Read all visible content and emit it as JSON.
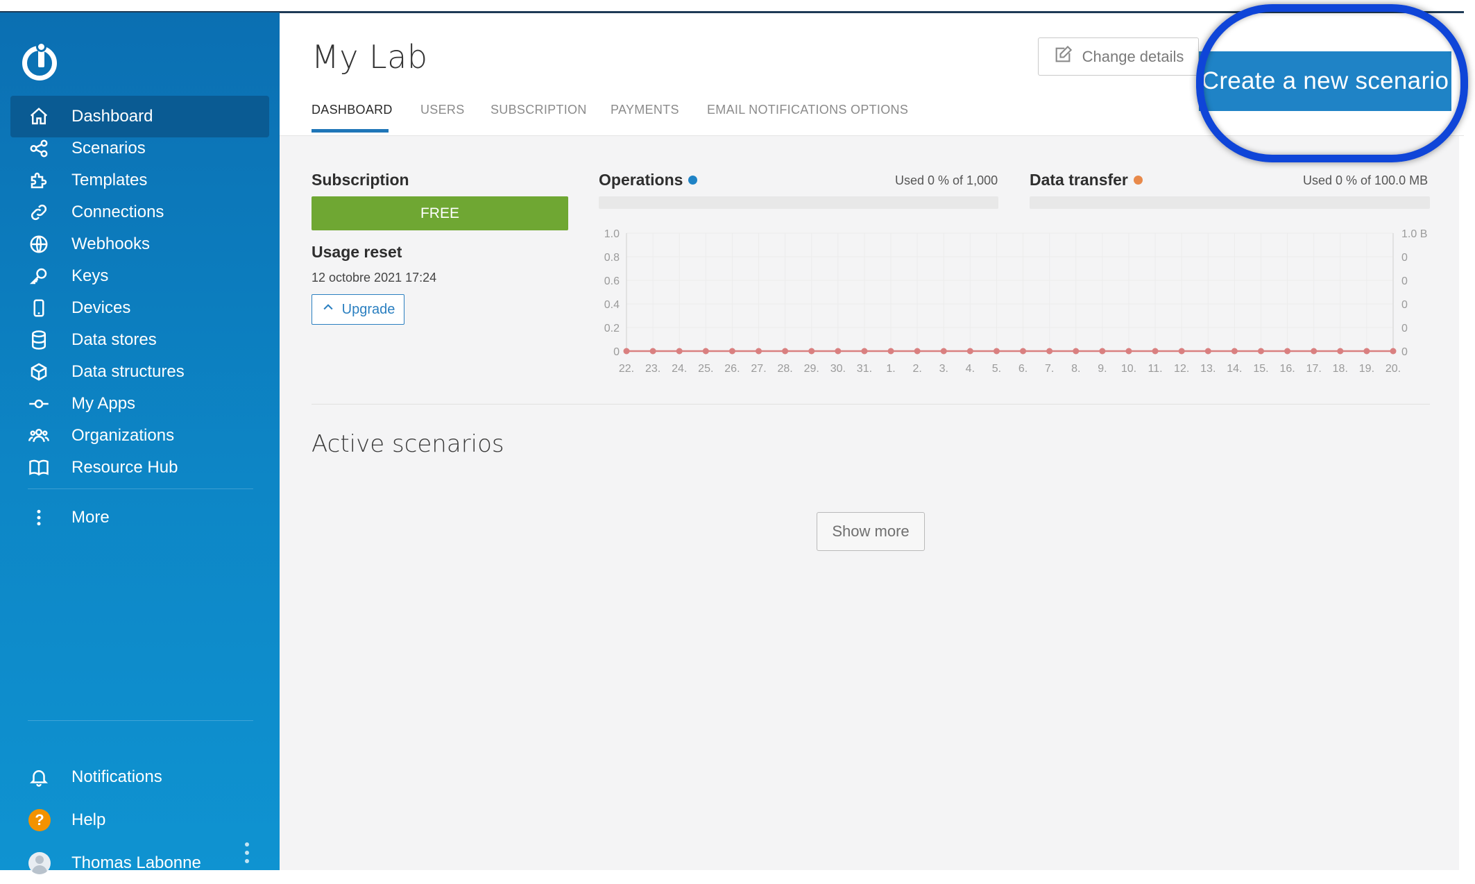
{
  "sidebar": {
    "items": [
      {
        "label": "Dashboard",
        "icon": "home-icon"
      },
      {
        "label": "Scenarios",
        "icon": "share-nodes-icon"
      },
      {
        "label": "Templates",
        "icon": "puzzle-icon"
      },
      {
        "label": "Connections",
        "icon": "link-icon"
      },
      {
        "label": "Webhooks",
        "icon": "globe-icon"
      },
      {
        "label": "Keys",
        "icon": "key-icon"
      },
      {
        "label": "Devices",
        "icon": "mobile-icon"
      },
      {
        "label": "Data stores",
        "icon": "database-icon"
      },
      {
        "label": "Data structures",
        "icon": "cube-icon"
      },
      {
        "label": "My Apps",
        "icon": "commit-node-icon"
      },
      {
        "label": "Organizations",
        "icon": "users-icon"
      },
      {
        "label": "Resource Hub",
        "icon": "book-icon"
      }
    ],
    "more": "More",
    "notifications": "Notifications",
    "help": "Help",
    "help_glyph": "?",
    "user_name": "Thomas Labonne"
  },
  "header": {
    "title": "My Lab",
    "tabs": [
      "DASHBOARD",
      "USERS",
      "SUBSCRIPTION",
      "PAYMENTS",
      "EMAIL NOTIFICATIONS OPTIONS"
    ],
    "change_details": "Change details",
    "create_scenario": "Create a new scenario"
  },
  "subscription": {
    "label": "Subscription",
    "plan": "FREE",
    "usage_reset_label": "Usage reset",
    "usage_reset_date": "12 octobre 2021 17:24",
    "upgrade": "Upgrade"
  },
  "usage": {
    "operations_label": "Operations",
    "operations_used": "Used 0 % of 1,000",
    "operations_fraction": 0,
    "data_transfer_label": "Data transfer",
    "data_transfer_used": "Used 0 % of 100.0 MB",
    "data_transfer_fraction": 0
  },
  "colors": {
    "operations": "#1f83c6",
    "data_transfer": "#e8894a",
    "series_line": "#d98080",
    "free_plan": "#6fa733",
    "highlight_ring": "#0f45d8"
  },
  "chart_data": {
    "type": "line",
    "categories": [
      "22.",
      "23.",
      "24.",
      "25.",
      "26.",
      "27.",
      "28.",
      "29.",
      "30.",
      "31.",
      "1.",
      "2.",
      "3.",
      "4.",
      "5.",
      "6.",
      "7.",
      "8.",
      "9.",
      "10.",
      "11.",
      "12.",
      "13.",
      "14.",
      "15.",
      "16.",
      "17.",
      "18.",
      "19.",
      "20."
    ],
    "left_axis_ticks": [
      "0",
      "0.2",
      "0.4",
      "0.6",
      "0.8",
      "1.0"
    ],
    "right_axis_ticks": [
      "0",
      "0",
      "0",
      "0",
      "0",
      "1.0 B"
    ],
    "ylim": [
      0,
      1
    ],
    "series": [
      {
        "values": [
          0,
          0,
          0,
          0,
          0,
          0,
          0,
          0,
          0,
          0,
          0,
          0,
          0,
          0,
          0,
          0,
          0,
          0,
          0,
          0,
          0,
          0,
          0,
          0,
          0,
          0,
          0,
          0,
          0,
          0
        ]
      }
    ],
    "grid": true
  },
  "active_scenarios": {
    "title": "Active scenarios",
    "show_more": "Show more"
  }
}
